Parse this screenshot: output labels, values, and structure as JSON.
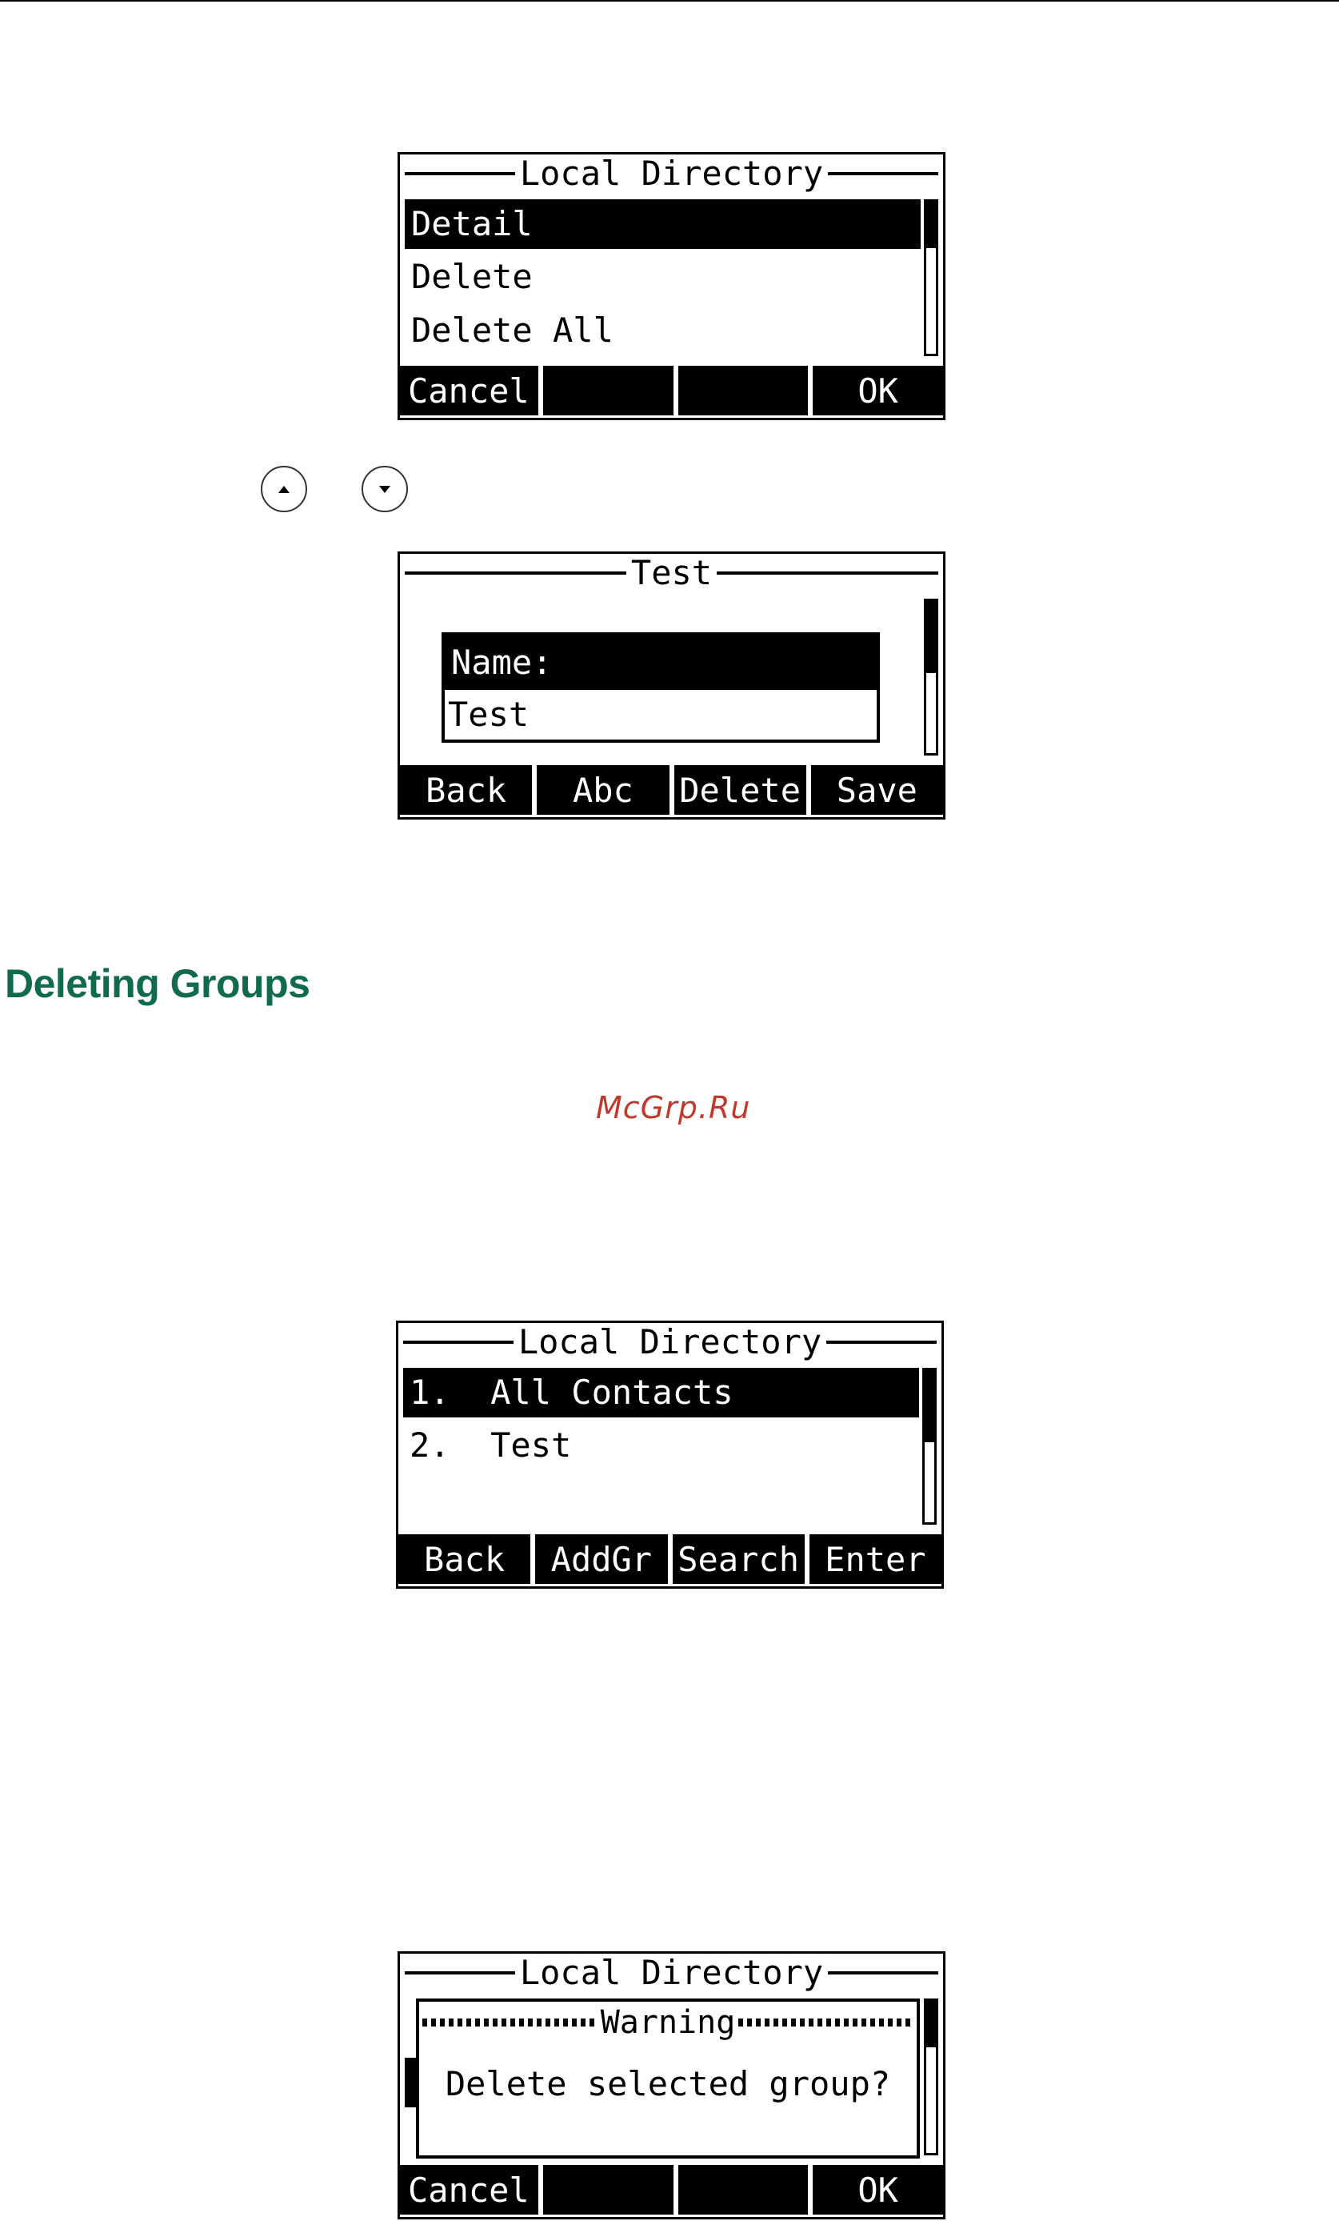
{
  "section_heading": "Deleting Groups",
  "watermark": "McGrp.Ru",
  "nav_icons": [
    "up-arrow-icon",
    "down-arrow-icon"
  ],
  "screen1": {
    "title": "Local Directory",
    "items": [
      "Detail",
      "Delete",
      "Delete All"
    ],
    "selected_index": 0,
    "softkeys": [
      "Cancel",
      "",
      "",
      "OK"
    ]
  },
  "screen2": {
    "title": "Test",
    "field_label": "Name:",
    "field_value": "Test",
    "softkeys": [
      "Back",
      "Abc",
      "Delete",
      "Save"
    ]
  },
  "screen3": {
    "title": "Local Directory",
    "items": [
      "1.  All Contacts",
      "2.  Test"
    ],
    "selected_index": 0,
    "softkeys": [
      "Back",
      "AddGr",
      "Search",
      "Enter"
    ]
  },
  "screen4": {
    "title": "Local Directory",
    "dialog_title": "Warning",
    "dialog_message": "Delete selected group?",
    "softkeys": [
      "Cancel",
      "",
      "",
      "OK"
    ]
  },
  "colors": {
    "heading": "#0f6b4c",
    "watermark": "#c0392b"
  }
}
